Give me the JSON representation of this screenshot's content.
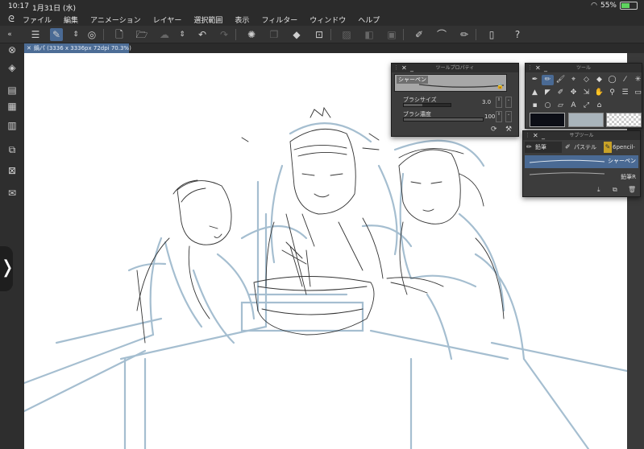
{
  "status_bar": {
    "time": "10:17",
    "date": "1月31日 (水)",
    "battery_text": "55%",
    "battery_level": 0.55,
    "wifi_icon": "wifi-icon"
  },
  "menu": [
    "ファイル",
    "編集",
    "アニメーション",
    "レイヤー",
    "選択範囲",
    "表示",
    "フィルター",
    "ウィンドウ",
    "ヘルプ"
  ],
  "document_tab": {
    "label": "鍋パ (3336 x 3336px 72dpi 70.3%)"
  },
  "tool_property": {
    "title": "ツールプロパティ",
    "preset_label": "シャーペン",
    "brush_size_label": "ブラシサイズ",
    "brush_size_value": "3.0",
    "brush_density_label": "ブラシ濃度",
    "brush_density_value": "100"
  },
  "tool_panel": {
    "title": "ツール"
  },
  "sub_tool_panel": {
    "title": "サブツール",
    "tabs": [
      "鉛筆",
      "パステル",
      "6pencil-"
    ],
    "items": [
      {
        "label": "シャーペン",
        "selected": true
      },
      {
        "label": "鉛筆R",
        "selected": false
      }
    ]
  },
  "colors": {
    "main": "#0c0e16",
    "sub": "#a9b4bb",
    "accent": "#4a6a94",
    "sketch_blue": "#9cb8cc"
  }
}
